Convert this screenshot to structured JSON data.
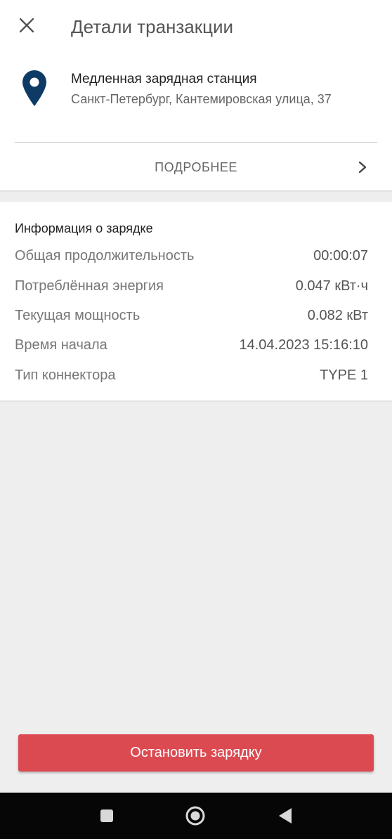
{
  "header": {
    "title": "Детали транзакции",
    "close_icon": "close-icon"
  },
  "station": {
    "icon": "location-pin-icon",
    "pin_color": "#0d3b66",
    "name": "Медленная зарядная станция",
    "address": "Санкт-Петербург, Кантемировская улица, 37"
  },
  "details_link": {
    "label": "ПОДРОБНЕЕ",
    "icon": "chevron-right-icon"
  },
  "charging_info": {
    "title": "Информация о зарядке",
    "rows": [
      {
        "label": "Общая продолжительность",
        "value": "00:00:07"
      },
      {
        "label": "Потреблённая энергия",
        "value": "0.047 кВт·ч"
      },
      {
        "label": "Текущая мощность",
        "value": "0.082 кВт"
      },
      {
        "label": "Время начала",
        "value": "14.04.2023 15:16:10"
      },
      {
        "label": "Тип коннектора",
        "value": "TYPE 1"
      }
    ]
  },
  "stop_button": {
    "label": "Остановить зарядку",
    "color": "#dc4a51"
  },
  "nav_bar": {
    "buttons": [
      "recent-apps-icon",
      "home-icon",
      "back-icon"
    ]
  }
}
